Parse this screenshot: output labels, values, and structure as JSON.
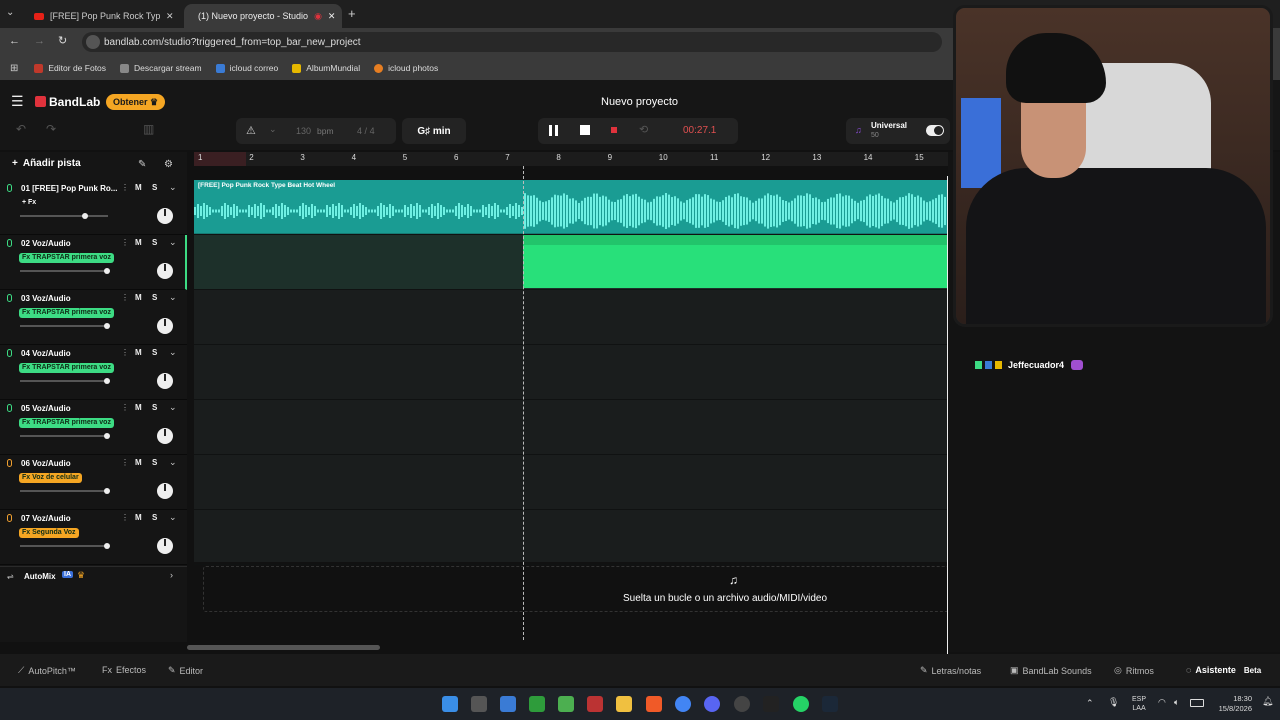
{
  "browser": {
    "tabs": [
      {
        "title": "[FREE] Pop Punk Rock Type Be"
      },
      {
        "title": "(1) Nuevo proyecto - Studio"
      }
    ],
    "url": "bandlab.com/studio?triggered_from=top_bar_new_project",
    "bookmarks": [
      {
        "label": "Editor de Fotos",
        "color": "#c0392b"
      },
      {
        "label": "Descargar stream",
        "color": "#888888"
      },
      {
        "label": "icloud correo",
        "color": "#3a7bd5"
      },
      {
        "label": "AlbumMundial",
        "color": "#e6b800"
      },
      {
        "label": "icloud photos",
        "color": "#e67e22"
      }
    ]
  },
  "app": {
    "brand": "BandLab",
    "get_button": "Obtener",
    "project_title": "Nuevo proyecto",
    "accent": "#3ddc84",
    "universal_label": "Universal",
    "universal_sub": "50",
    "pro_icon_color": "#8a4bd6"
  },
  "transport": {
    "bpm_value": "130",
    "bpm_unit": "bpm",
    "time_sig_num": "4",
    "time_sig_sep": "/",
    "time_sig_den": "4",
    "key": "G♯ min",
    "time": "00:27.1"
  },
  "tracklist": {
    "add_track": "Añadir pista",
    "automix": "AutoMix",
    "ia_badge": "IA",
    "tracks": [
      {
        "name": "01  [FREE] Pop Punk Ro...",
        "fx": "+ Fx",
        "fx_style": "plain",
        "mic": "green"
      },
      {
        "name": "02  Voz/Audio",
        "fx": "Fx TRAPSTAR primera voz",
        "fx_style": "green",
        "mic": "green"
      },
      {
        "name": "03  Voz/Audio",
        "fx": "Fx TRAPSTAR primera voz",
        "fx_style": "green",
        "mic": "green"
      },
      {
        "name": "04  Voz/Audio",
        "fx": "Fx TRAPSTAR primera voz",
        "fx_style": "green",
        "mic": "green"
      },
      {
        "name": "05  Voz/Audio",
        "fx": "Fx TRAPSTAR primera voz",
        "fx_style": "green",
        "mic": "green"
      },
      {
        "name": "06  Voz/Audio",
        "fx": "Fx Voz de celular",
        "fx_style": "orange",
        "mic": "orange"
      },
      {
        "name": "07  Voz/Audio",
        "fx": "Fx Segunda Voz",
        "fx_style": "orange",
        "mic": "orange"
      }
    ],
    "mute_label": "M",
    "solo_label": "S"
  },
  "timeline": {
    "bars": [
      "1",
      "2",
      "3",
      "4",
      "5",
      "6",
      "7",
      "8",
      "9",
      "10",
      "11",
      "12",
      "13",
      "14",
      "15"
    ],
    "clip1_title": "[FREE] Pop Punk Rock Type Beat Hot Wheel",
    "drop_zone_text": "Suelta un bucle o un archivo audio/MIDI/video"
  },
  "overlay": {
    "username": "Jeffecuador4"
  },
  "bottombar": {
    "autopitch": "AutoPitch™",
    "effects": "Efectos",
    "editor": "Editor",
    "lyrics": "Letras/notas",
    "sounds": "BandLab Sounds",
    "rhythms": "Ritmos",
    "assistant": "Asistente",
    "beta": "Beta"
  },
  "taskbar": {
    "lang": "ESP",
    "lang_sub": "LAA",
    "time": "18:30",
    "date": "15/8/2026"
  }
}
